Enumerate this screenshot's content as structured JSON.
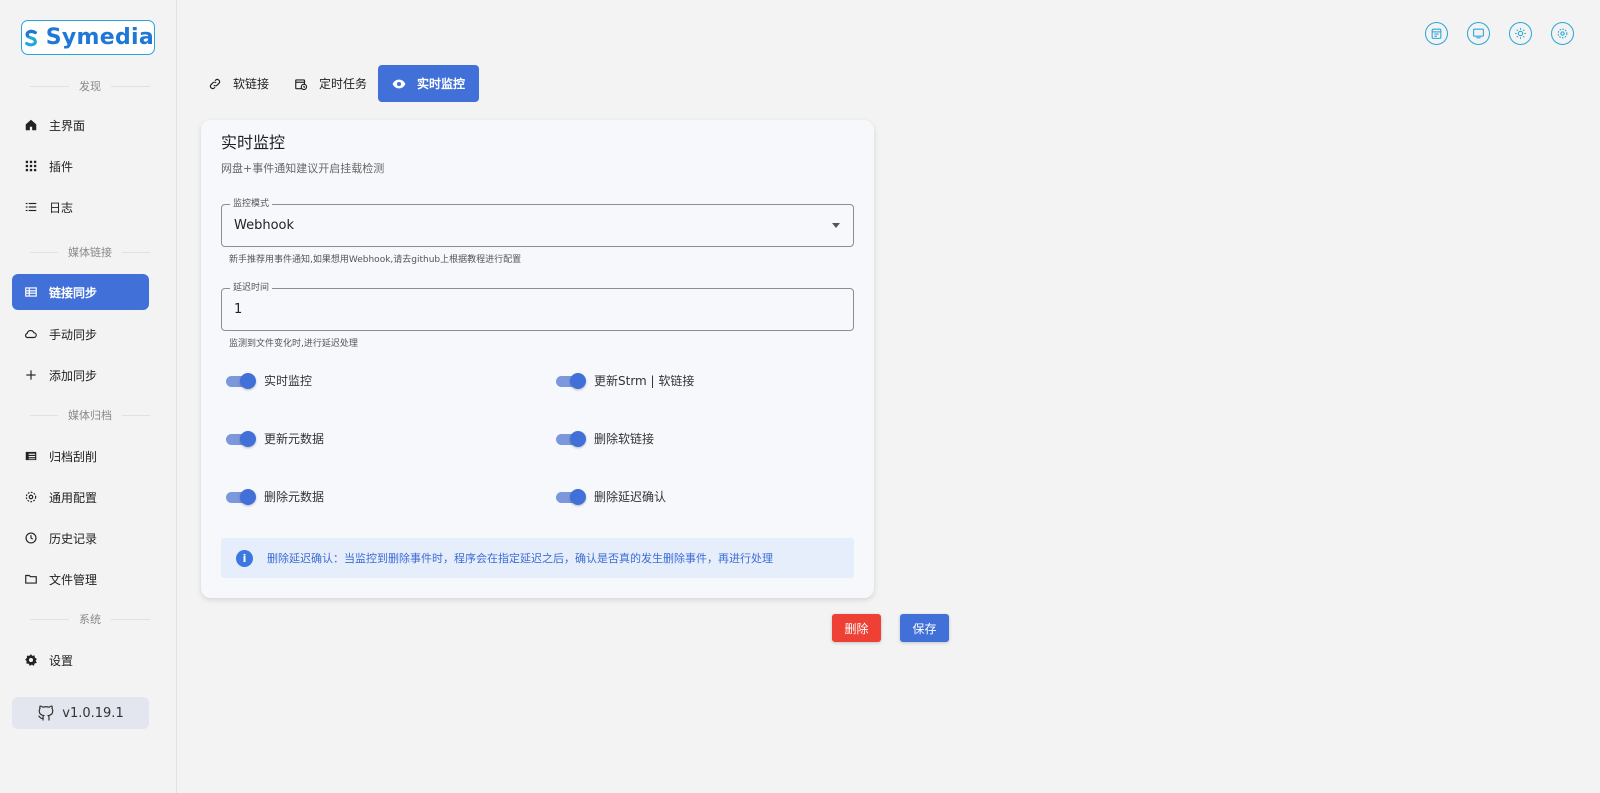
{
  "app": {
    "logo_text": "Symedia",
    "version": "v1.0.19.1"
  },
  "sidebar": {
    "sections": [
      "发现",
      "媒体链接",
      "媒体归档",
      "系统"
    ],
    "items": [
      {
        "label": "主界面",
        "icon": "home-icon"
      },
      {
        "label": "插件",
        "icon": "grid-icon"
      },
      {
        "label": "日志",
        "icon": "list-icon"
      },
      {
        "label": "链接同步",
        "icon": "table-icon",
        "active": true
      },
      {
        "label": "手动同步",
        "icon": "cloud-sync-icon"
      },
      {
        "label": "添加同步",
        "icon": "plus-icon"
      },
      {
        "label": "归档刮削",
        "icon": "archive-icon"
      },
      {
        "label": "通用配置",
        "icon": "cog-icon"
      },
      {
        "label": "历史记录",
        "icon": "history-icon"
      },
      {
        "label": "文件管理",
        "icon": "folder-icon"
      },
      {
        "label": "设置",
        "icon": "settings-icon"
      }
    ]
  },
  "header": {
    "icons": [
      "calendar-icon",
      "monitor-icon",
      "sun-icon",
      "gear-icon"
    ]
  },
  "tabs": [
    {
      "label": "软链接",
      "icon": "link-icon"
    },
    {
      "label": "定时任务",
      "icon": "calendar-clock-icon"
    },
    {
      "label": "实时监控",
      "icon": "eye-icon",
      "active": true
    }
  ],
  "card": {
    "title": "实时监控",
    "subtitle": "网盘+事件通知建议开启挂载检测",
    "mode_field": {
      "label": "监控模式",
      "value": "Webhook",
      "hint": "新手推荐用事件通知,如果想用Webhook,请去github上根据教程进行配置"
    },
    "delay_field": {
      "label": "延迟时间",
      "value": "1",
      "hint": "监测到文件变化时,进行延迟处理"
    },
    "toggles": [
      {
        "label": "实时监控",
        "on": true
      },
      {
        "label": "更新Strm | 软链接",
        "on": true
      },
      {
        "label": "更新元数据",
        "on": true
      },
      {
        "label": "删除软链接",
        "on": true
      },
      {
        "label": "删除元数据",
        "on": true
      },
      {
        "label": "删除延迟确认",
        "on": true
      }
    ],
    "info": "删除延迟确认：当监控到删除事件时，程序会在指定延迟之后，确认是否真的发生删除事件，再进行处理"
  },
  "actions": {
    "delete_label": "删除",
    "save_label": "保存"
  },
  "colors": {
    "accent": "#4070d8",
    "danger": "#ee4034",
    "brand": "#27a7d8"
  }
}
